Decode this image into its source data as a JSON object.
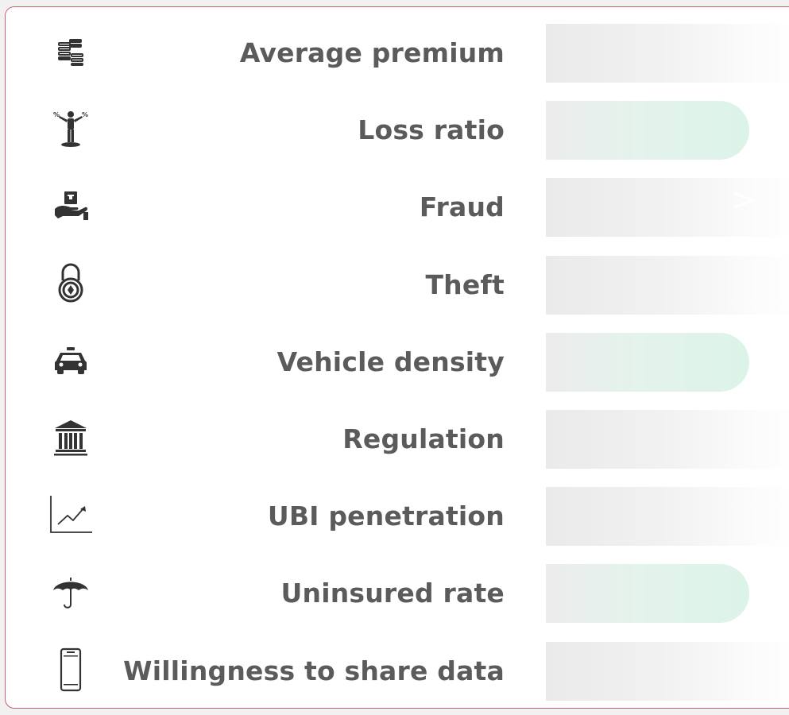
{
  "factors": [
    {
      "key": "average-premium",
      "label": "Average premium",
      "icon": "coins-stack-icon",
      "bar": "long",
      "interactable": false
    },
    {
      "key": "loss-ratio",
      "label": "Loss ratio",
      "icon": "balance-person-icon",
      "bar": "short",
      "interactable": false
    },
    {
      "key": "fraud",
      "label": "Fraud",
      "icon": "hand-with-box-icon",
      "bar": "long",
      "interactable": false
    },
    {
      "key": "theft",
      "label": "Theft",
      "icon": "padlock-icon",
      "bar": "long",
      "interactable": false
    },
    {
      "key": "vehicle-density",
      "label": "Vehicle density",
      "icon": "car-icon",
      "bar": "short",
      "interactable": false
    },
    {
      "key": "regulation",
      "label": "Regulation",
      "icon": "bank-building-icon",
      "bar": "long",
      "interactable": false
    },
    {
      "key": "ubi-penetration",
      "label": "UBI penetration",
      "icon": "line-chart-icon",
      "bar": "long",
      "interactable": false
    },
    {
      "key": "uninsured-rate",
      "label": "Uninsured rate",
      "icon": "umbrella-icon",
      "bar": "short",
      "interactable": false
    },
    {
      "key": "willingness-to-share-data",
      "label": "Willingness to share data",
      "icon": "smartphone-icon",
      "bar": "long",
      "interactable": false
    }
  ],
  "overlay_glyph": ">",
  "colors": {
    "border": "#c9626f",
    "label": "#5b5b5b",
    "icon": "#333333",
    "bar_gray": "#eaeaea",
    "bar_green": "#dcf3e8"
  }
}
